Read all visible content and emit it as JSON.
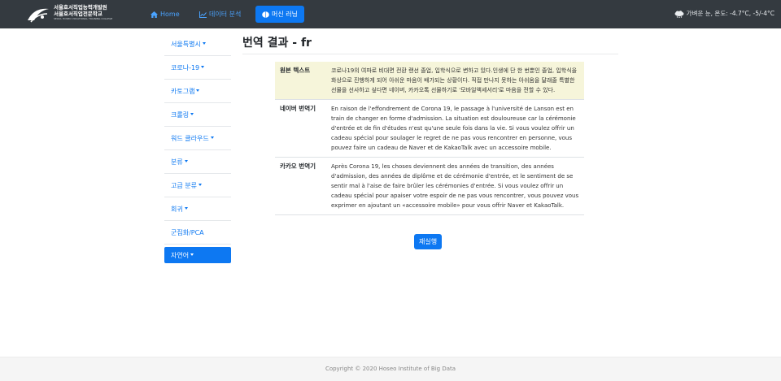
{
  "brand": {
    "line1": "서울호서직업능력개발원",
    "line2": "서울호서직업전문학교",
    "line3": "SEOUL HOSEO VOCATIONAL TRAINING COLLEGE"
  },
  "nav": {
    "home": "Home",
    "data_analysis": "데이터 분석",
    "machine_learning": "머신 러닝"
  },
  "weather": {
    "text": "가벼운 눈, 온도: -4.7°C, -5/-4°C"
  },
  "sidebar": {
    "items": [
      {
        "label": "서울특별시",
        "dropdown": true
      },
      {
        "label": "코로나-19",
        "dropdown": true
      },
      {
        "label": "카토그램",
        "dropdown": true
      },
      {
        "label": "크롤링",
        "dropdown": true
      },
      {
        "label": "워드 클라우드",
        "dropdown": true
      },
      {
        "label": "분류",
        "dropdown": true
      },
      {
        "label": "고급 분류",
        "dropdown": true
      },
      {
        "label": "회귀",
        "dropdown": true
      },
      {
        "label": "군집화/PCA",
        "dropdown": false
      }
    ],
    "active": {
      "label": "자연어",
      "dropdown": true
    }
  },
  "page": {
    "title": "번역 결과 - fr"
  },
  "results": [
    {
      "label": "원본 텍스트",
      "text": "코로나19의 여파로 비대면 전환 랜선 졸업, 입학식으로 변하고 있다.인생에 단 한 번뿐인 졸업, 입학식을 화상으로 진행하게 되어 아쉬운 마음이 배가되는 상황이다. 직접 만나지 못하는 아쉬움을 달래줄 특별한 선물을 선사하고 싶다면 네이버, 카카오톡 선물하기로 '모바일액세서리'로 마음을 전할 수 있다."
    },
    {
      "label": "네이버 번역기",
      "text": "En raison de l'effondrement de Corona 19, le passage à l'université de Lanson est en train de changer en forme d'admission. La situation est douloureuse car la cérémonie d'entrée et de fin d'études n'est qu'une seule fois dans la vie. Si vous voulez offrir un cadeau spécial pour soulager le regret de ne pas vous rencontrer en personne, vous pouvez faire un cadeau de Naver et de KakaoTalk avec un accessoire mobile."
    },
    {
      "label": "카카오 번역기",
      "text": "Après Corona 19, les choses deviennent des années de transition, des années d'admission, des années de diplôme et de cérémonie d'entrée, et le sentiment de se sentir mal à l'aise de faire brûler les cérémonies d'entrée. Si vous voulez offrir un cadeau spécial pour apaiser votre espoir de ne pas vous rencontrer, vous pouvez vous exprimer en ajoutant un «accessoire mobile» pour vous offrir Naver et KakaoTalk."
    }
  ],
  "actions": {
    "rerun": "재실행"
  },
  "footer": {
    "copyright": "Copyright © 2020 Hoseo Institute of Big Data"
  },
  "colors": {
    "navbar": "#343a40",
    "accent": "#0d78f2",
    "source_row": "#f6f5da"
  }
}
